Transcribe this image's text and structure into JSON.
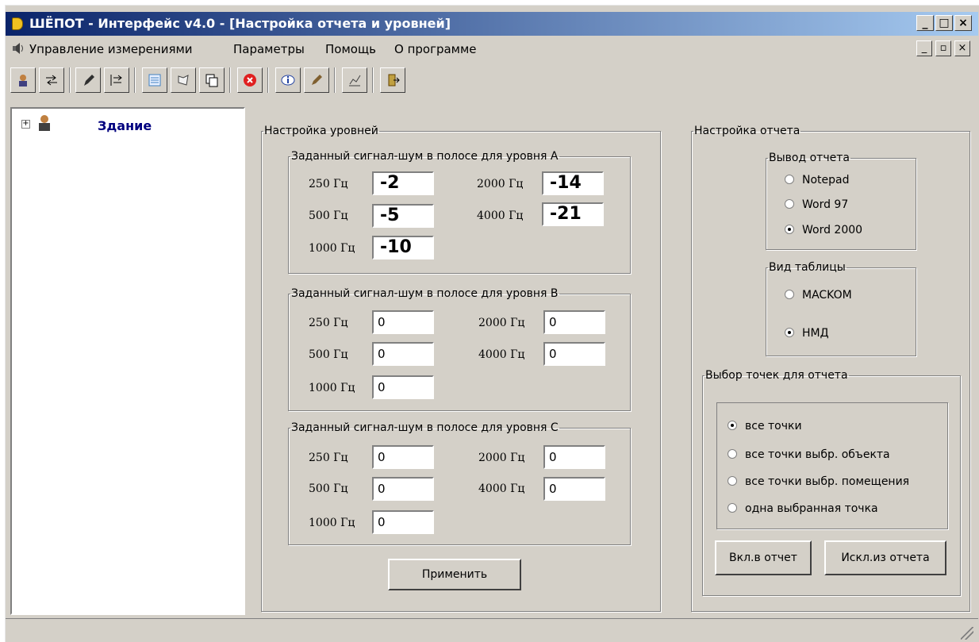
{
  "window": {
    "title": "ШЁПОТ - Интерфейс v4.0 - [Настройка отчета и уровней]"
  },
  "menu": [
    "Управление измерениями",
    "Параметры",
    "Помощь",
    "О программе"
  ],
  "toolbar_icons": [
    "person-icon",
    "arrow-in-icon",
    "pen-icon",
    "arrow-out-icon",
    "list-icon",
    "pen-paper-icon",
    "copy-icon",
    "stop-icon",
    "info-icon",
    "pen-edit-icon",
    "chart-icon",
    "exit-icon"
  ],
  "tree": {
    "root": "Здание"
  },
  "levels": {
    "title": "Настройка уровней",
    "groups": [
      {
        "legend": "Заданный сигнал-шум в полосе для уровня  A",
        "f250": "250 Гц",
        "f500": "500 Гц",
        "f1000": "1000 Гц",
        "f2000": "2000 Гц",
        "f4000": "4000 Гц",
        "v250": "-2",
        "v500": "-5",
        "v1000": "-10",
        "v2000": "-14",
        "v4000": "-21"
      },
      {
        "legend": "Заданный сигнал-шум в полосе для уровня  B",
        "f250": "250 Гц",
        "f500": "500 Гц",
        "f1000": "1000 Гц",
        "f2000": "2000 Гц",
        "f4000": "4000 Гц",
        "v250": "0",
        "v500": "0",
        "v1000": "0",
        "v2000": "0",
        "v4000": "0"
      },
      {
        "legend": "Заданный сигнал-шум в полосе для уровня С",
        "f250": "250 Гц",
        "f500": "500 Гц",
        "f1000": "1000 Гц",
        "f2000": "2000 Гц",
        "f4000": "4000 Гц",
        "v250": "0",
        "v500": "0",
        "v1000": "0",
        "v2000": "0",
        "v4000": "0"
      }
    ],
    "apply": "Применить"
  },
  "report": {
    "title": "Настройка отчета",
    "output_legend": "Вывод отчета",
    "outputs": [
      "Notepad",
      "Word 97",
      "Word 2000"
    ],
    "output_selected": "Word 2000",
    "table_legend": "Вид таблицы",
    "tables": [
      "MACKOM",
      "НМД"
    ],
    "table_selected": "НМД",
    "points_legend": "Выбор точек для отчета",
    "points": [
      "все точки",
      "все точки выбр. объекта",
      "все точки выбр. помещения",
      "одна выбранная точка"
    ],
    "points_selected": "все точки",
    "include": "Вкл.в отчет",
    "exclude": "Искл.из отчета"
  }
}
